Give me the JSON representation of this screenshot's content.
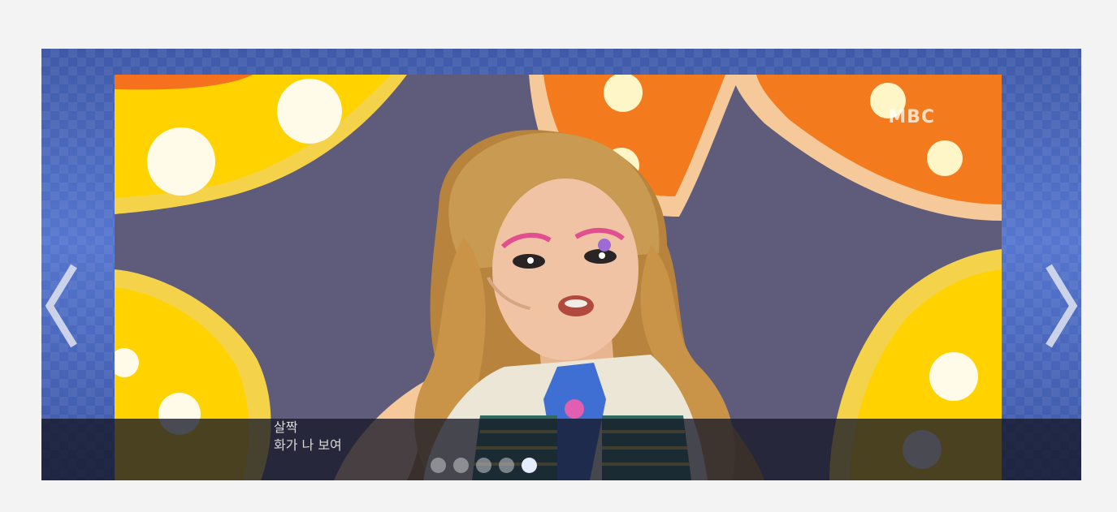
{
  "slideshow": {
    "watermark": "MBC",
    "caption": {
      "line1": "살짝",
      "line2": "화가 나 보여"
    },
    "prev_icon": "chevron-left-icon",
    "next_icon": "chevron-right-icon",
    "pagination": {
      "total": 5,
      "active_index": 4
    },
    "colors": {
      "frame": "#4a66b8",
      "active_dot": "#e6ecff",
      "inactive_dot": "#c8c8cd"
    }
  }
}
